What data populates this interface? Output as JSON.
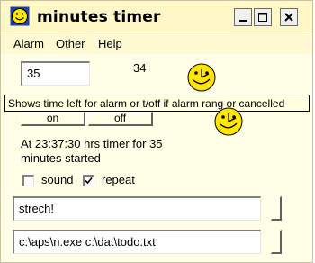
{
  "window": {
    "title": "minutes timer",
    "icons": {
      "app": "smiley-clock-icon",
      "minimize": "minimize-icon",
      "maximize": "maximize-icon",
      "close": "close-icon"
    }
  },
  "menu": [
    "Alarm",
    "Other",
    "Help"
  ],
  "timer": {
    "minutes_value": "35",
    "time_left": "34",
    "on_label": "on",
    "off_label": "off",
    "status": "At 23:37:30 hrs timer for 35 minutes started"
  },
  "tooltip": "Shows time left for alarm or t/off if alarm rang or cancelled",
  "options": {
    "sound_label": "sound",
    "sound_checked": false,
    "repeat_label": "repeat",
    "repeat_checked": true
  },
  "message_value": "strech!",
  "command_value": "c:\\aps\\n.exe c:\\dat\\todo.txt",
  "colors": {
    "background": "#fffee6",
    "smiley": "#ffe600"
  }
}
